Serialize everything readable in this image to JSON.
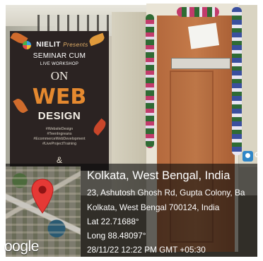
{
  "banner": {
    "brand": "NIELIT",
    "presents": "Presents",
    "line1": "SEMINAR CUM",
    "line2": "LIVE WORKSHOP",
    "line3": "ON",
    "line4": "WEB",
    "line5": "DESIGN",
    "hashtags": [
      "#WebsiteDesign",
      "#TeenIngreans",
      "#EcommerceWebDevelopment",
      "#LiveProjectTraining"
    ],
    "ampersand": "&"
  },
  "gps_overlay": {
    "place": "Kolkata, West Bengal, India",
    "address_line1": "23, Ashutosh Ghosh Rd, Gupta Colony, Ba",
    "address_line2": "Kolkata, West Bengal 700124, India",
    "lat": "Lat 22.71688°",
    "long": "Long 88.48097°",
    "datetime": "28/11/22 12:22 PM GMT +05:30",
    "map_attribution": "oogle",
    "app_letter": "G"
  },
  "colors": {
    "overlay": "#0c0c0c",
    "pin": "#e53935",
    "banner_bg": "#2b2322",
    "banner_accent": "#e5892f",
    "door": "#c57b4a"
  },
  "icons": {
    "pin": "map-pin-icon",
    "app": "gps-camera-app-icon"
  }
}
